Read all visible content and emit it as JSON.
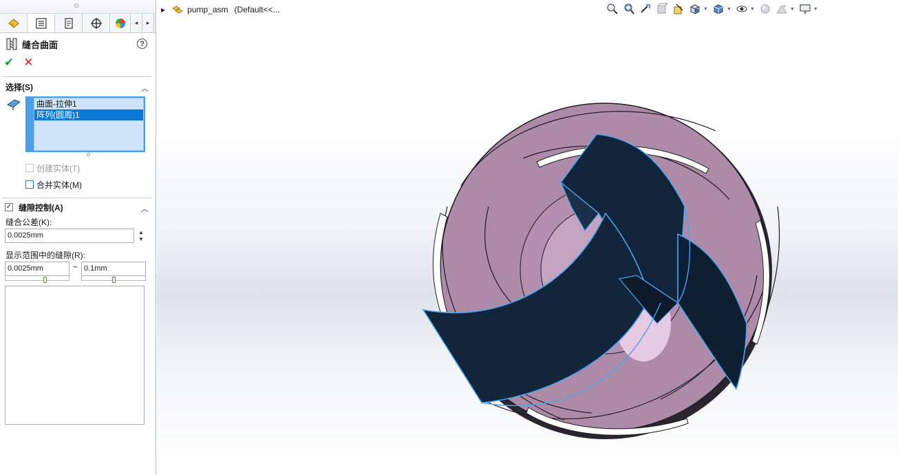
{
  "property_manager": {
    "tabs": [
      {
        "name": "display-pane-tab"
      },
      {
        "name": "feature-manager-tab",
        "active": true
      },
      {
        "name": "property-manager-tab"
      },
      {
        "name": "configuration-manager-tab"
      },
      {
        "name": "appearance-tab"
      }
    ],
    "feature_title": "缝合曲面",
    "help_label": "?",
    "ok_label": "✔",
    "cancel_label": "✕",
    "selection_section": {
      "title": "选择(S)",
      "items": [
        "曲面-拉伸1",
        "阵列(圆周)1"
      ],
      "selected_index": 1,
      "create_solid": {
        "label": "创建实体(T)",
        "checked": false,
        "enabled": false
      },
      "merge_entities": {
        "label": "合并实体(M)",
        "checked": false,
        "enabled": true
      }
    },
    "gap_control_section": {
      "title": "缝隙控制(A)",
      "checked": true,
      "stitch_tolerance_label": "缝合公差(K):",
      "stitch_tolerance_value": "0.0025mm",
      "gap_range_label": "显示范围中的缝隙(R):",
      "gap_range_min": "0.0025mm",
      "gap_range_separator": "~",
      "gap_range_max": "0.1mm"
    }
  },
  "viewport": {
    "assembly_name": "pump_asm",
    "assembly_config": "(Default<<...",
    "toolbar_icons": [
      "zoom-to-fit-icon",
      "zoom-to-area-icon",
      "previous-view-icon",
      "section-view-icon",
      "dynamic-annotation-icon",
      "view-orientation-icon",
      "display-style-icon",
      "hide-show-items-icon",
      "edit-appearance-icon",
      "apply-scene-icon",
      "view-settings-icon"
    ]
  },
  "colors": {
    "selection_blue": "#0a78d4",
    "list_bg": "#cfe4f8",
    "ok_green": "#1c9a2c",
    "cancel_red": "#d42222",
    "impeller_face": "#ad8aa8",
    "selected_surface": "#12243a",
    "edge_highlight": "#4ea3ea"
  }
}
